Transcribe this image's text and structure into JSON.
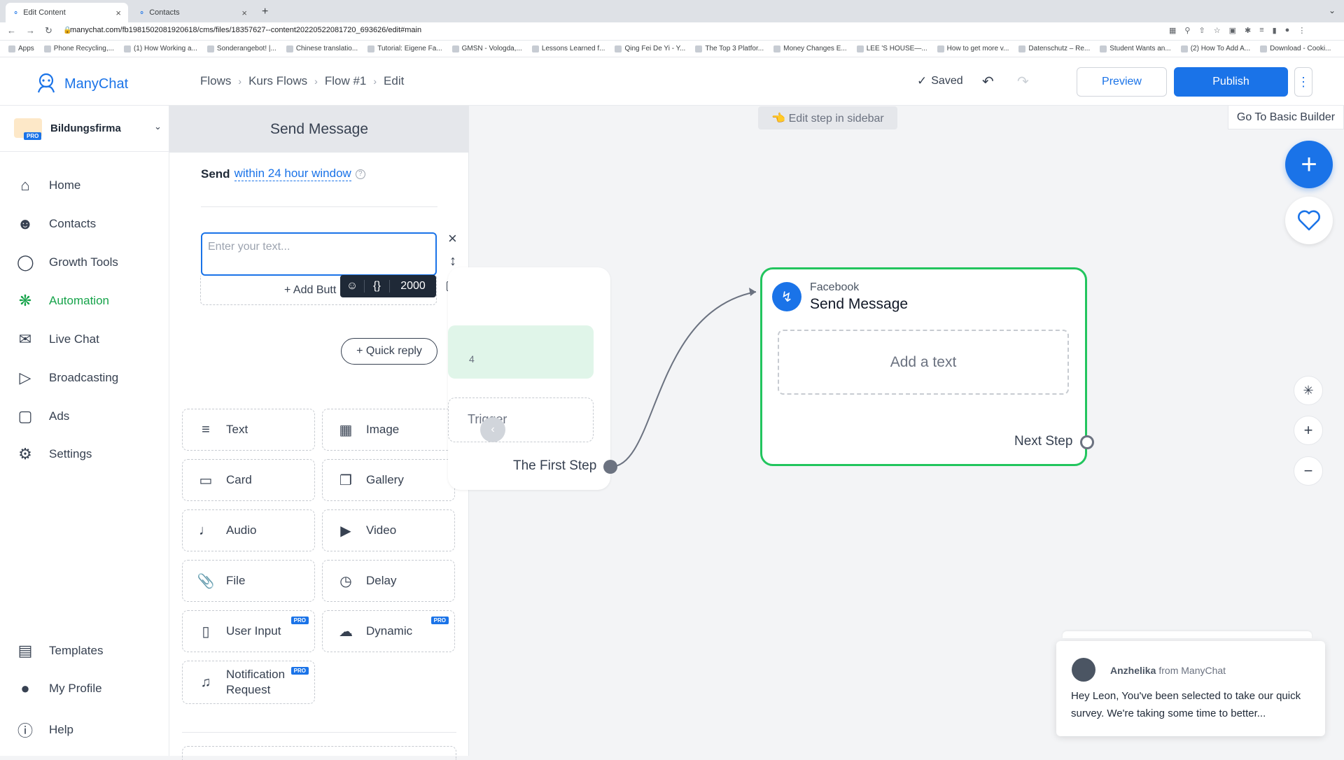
{
  "browser": {
    "tabs": [
      {
        "label": "Edit Content",
        "active": true
      },
      {
        "label": "Contacts",
        "active": false
      }
    ],
    "url": "manychat.com/fb198150208192061​8/cms/files/18357627--content20220522081720_693626/edit#main",
    "bookmarks": [
      "Apps",
      "Phone Recycling,...",
      "(1) How Working a...",
      "Sonderangebot! |...",
      "Chinese translatio...",
      "Tutorial: Eigene Fa...",
      "GMSN - Vologda,...",
      "Lessons Learned f...",
      "Qing Fei De Yi - Y...",
      "The Top 3 Platfor...",
      "Money Changes E...",
      "LEE 'S HOUSE—...",
      "How to get more v...",
      "Datenschutz – Re...",
      "Student Wants an...",
      "(2) How To Add A...",
      "Download - Cooki..."
    ]
  },
  "app": {
    "logo": "ManyChat",
    "breadcrumb": [
      "Flows",
      "Kurs Flows",
      "Flow #1",
      "Edit"
    ],
    "saved": "Saved",
    "preview": "Preview",
    "publish": "Publish"
  },
  "sidebar": {
    "account": "Bildungsfirma",
    "account_badge": "PRO",
    "items": [
      "Home",
      "Contacts",
      "Growth Tools",
      "Automation",
      "Live Chat",
      "Broadcasting",
      "Ads",
      "Settings"
    ],
    "bottom": [
      "Templates",
      "My Profile",
      "Help"
    ]
  },
  "panel": {
    "title": "Send Message",
    "send_prefix": "Send",
    "send_link": "within 24 hour window",
    "text_placeholder": "Enter your text...",
    "char_count": "2000",
    "add_button": "+ Add Butt",
    "quick_reply": "+ Quick reply",
    "blocks": [
      {
        "label": "Text",
        "icon": "text-lines-icon",
        "pro": false
      },
      {
        "label": "Image",
        "icon": "image-icon",
        "pro": false
      },
      {
        "label": "Card",
        "icon": "card-icon",
        "pro": false
      },
      {
        "label": "Gallery",
        "icon": "gallery-icon",
        "pro": false
      },
      {
        "label": "Audio",
        "icon": "speaker-icon",
        "pro": false
      },
      {
        "label": "Video",
        "icon": "video-icon",
        "pro": false
      },
      {
        "label": "File",
        "icon": "paperclip-icon",
        "pro": false
      },
      {
        "label": "Delay",
        "icon": "clock-icon",
        "pro": false
      },
      {
        "label": "User Input",
        "icon": "input-icon",
        "pro": true
      },
      {
        "label": "Dynamic",
        "icon": "cloud-icon",
        "pro": true
      },
      {
        "label": "Notification Request",
        "icon": "bell-icon",
        "pro": true
      }
    ],
    "pro_badge": "PRO"
  },
  "canvas": {
    "edit_hint": "👈 Edit step in sidebar",
    "basic_builder": "Go To Basic Builder",
    "start_node": {
      "partial_text": "4",
      "trigger": "Trigger",
      "first_step": "The First Step"
    },
    "message_node": {
      "channel": "Facebook",
      "title": "Send Message",
      "add_text": "Add a text",
      "next_step": "Next Step"
    }
  },
  "chat_popup": {
    "author": "Anzhelika",
    "from": "from ManyChat",
    "message": "Hey Leon,  You've been selected to take our quick survey. We're taking some time to better..."
  },
  "colors": {
    "brand": "#1a73e8",
    "accent_green": "#16a34a",
    "node_border": "#22c55e"
  }
}
